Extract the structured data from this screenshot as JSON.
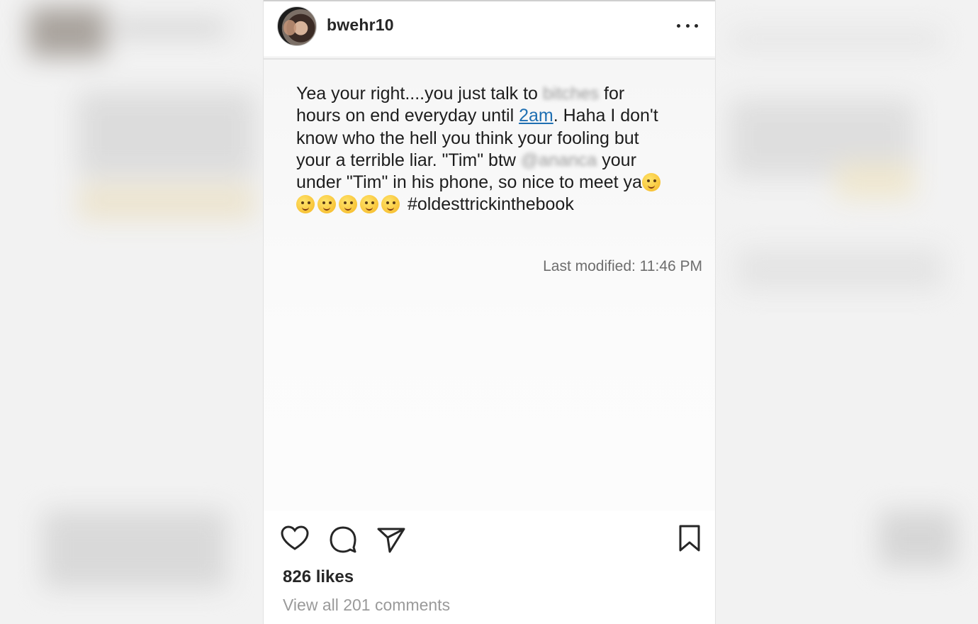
{
  "header": {
    "username": "bwehr10"
  },
  "note": {
    "line1_a": "Yea your right....you just talk to ",
    "line1_blur": "bitches",
    "line1_b": " for",
    "line2_a": "hours on end everyday until ",
    "line2_link": "2am",
    "line2_b": ". Haha I don't",
    "line3": "know who the hell you think your fooling but",
    "line4_a": "your a terrible liar. \"Tim\" btw ",
    "line4_blur": "@ananca",
    "line4_b": " your",
    "line5": "under \"Tim\" in his phone, so nice to meet ya",
    "hashtag": "#oldesttrickinthebook",
    "last_modified": "Last modified: 11:46 PM"
  },
  "actions": {
    "like_icon": "heart-icon",
    "comment_icon": "comment-icon",
    "share_icon": "send-icon",
    "save_icon": "bookmark-icon"
  },
  "stats": {
    "likes": "826 likes",
    "comments": "View all 201 comments"
  },
  "colors": {
    "link": "#1f6fb2",
    "text": "#262626",
    "muted": "#9a9a9a"
  }
}
